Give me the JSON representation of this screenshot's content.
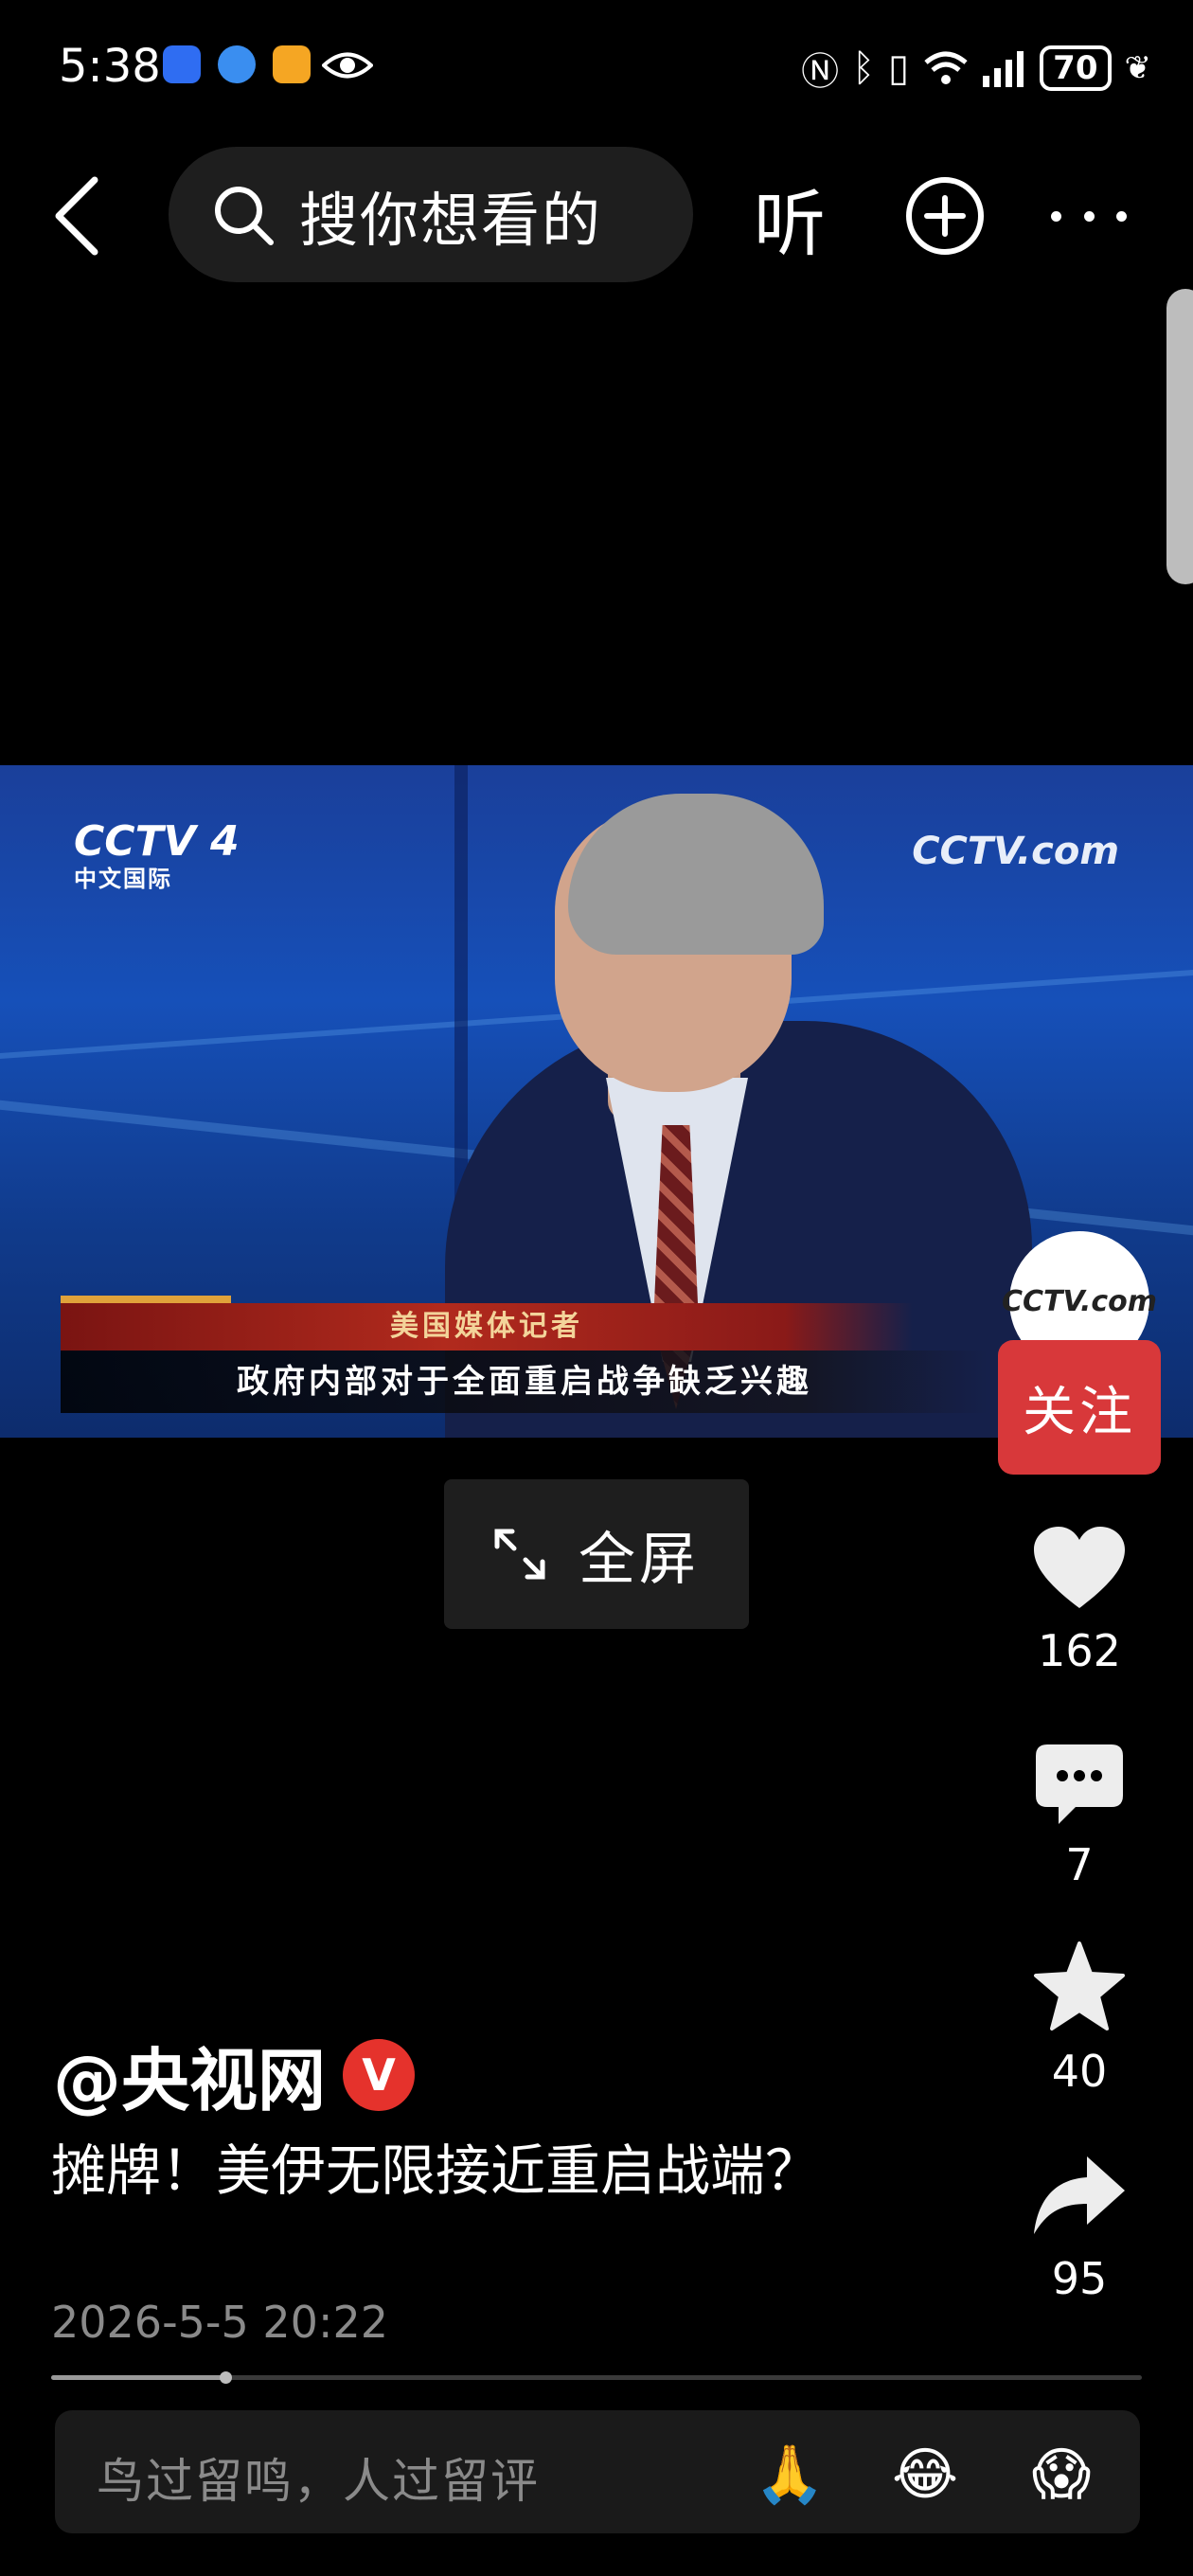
{
  "status_bar": {
    "time": "5:38",
    "battery": "70",
    "app_icons": [
      "weather-app-icon",
      "browser-app-icon",
      "health-app-icon",
      "eye-icon"
    ],
    "status_icons": [
      "nfc-icon",
      "bluetooth-icon",
      "vibrate-icon",
      "wifi-icon",
      "signal-icon",
      "leaf-icon"
    ]
  },
  "top_nav": {
    "search_placeholder": "搜你想看的",
    "listen_label": "听"
  },
  "video": {
    "channel_logo_left": "CCTV 4",
    "channel_logo_left_sub": "中文国际",
    "channel_logo_right": "CCTV.com",
    "caption_name": "美国媒体记者",
    "caption_text": "政府内部对于全面重启战争缺乏兴趣"
  },
  "fullscreen_label": "全屏",
  "rail": {
    "avatar_text": "CCTV.com",
    "follow_label": "关注",
    "likes": "162",
    "comments": "7",
    "favorites": "40",
    "shares": "95"
  },
  "post": {
    "author": "@央视网",
    "verified_badge": "V",
    "title": "摊牌！美伊无限接近重启战端？",
    "time": "2026-5-5 20:22",
    "progress_fraction": 0.16
  },
  "comment_bar": {
    "placeholder": "鸟过留鸣，人过留评",
    "emojis": [
      "🙏",
      "😂",
      "😱"
    ]
  },
  "colors": {
    "background": "#000000",
    "follow_red": "#d8383a",
    "verified_red": "#e5322c",
    "muted_text": "#8a8a8a"
  }
}
